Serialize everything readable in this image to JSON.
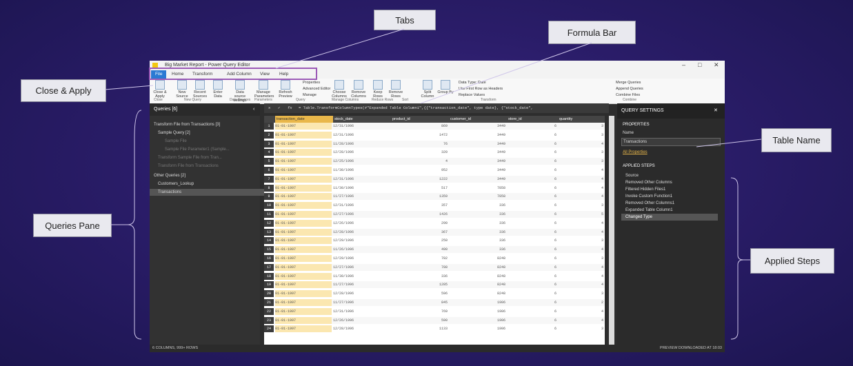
{
  "callouts": {
    "tabs": "Tabs",
    "formula_bar": "Formula Bar",
    "close_apply": "Close & Apply",
    "table_name": "Table Name",
    "queries_pane": "Queries Pane",
    "applied_steps": "Applied Steps"
  },
  "window": {
    "title": "Big Market Report - Power Query Editor",
    "minimize": "–",
    "maximize": "□",
    "close": "✕"
  },
  "tabs": [
    "File",
    "Home",
    "Transform",
    "Add Column",
    "View",
    "Help"
  ],
  "ribbon": {
    "buttons": [
      "Close & Apply",
      "New Source",
      "Recent Sources",
      "Enter Data",
      "Data source settings",
      "Manage Parameters",
      "Refresh Preview",
      "Choose Columns",
      "Remove Columns",
      "Keep Rows",
      "Remove Rows",
      "Split Column",
      "Group By"
    ],
    "small": [
      "Properties",
      "Advanced Editor",
      "Manage",
      "Data Type: Date",
      "Use First Row as Headers",
      "Replace Values",
      "Merge Queries",
      "Append Queries",
      "Combine Files"
    ],
    "groups": [
      "Close",
      "New Query",
      "Data Sources",
      "Parameters",
      "Query",
      "Manage Columns",
      "Reduce Rows",
      "Sort",
      "Transform",
      "Combine"
    ]
  },
  "queries": {
    "header": "Queries [6]",
    "items": [
      "Transform File from Transactions [3]",
      "Sample Query [2]",
      "Sample File",
      "Sample File Parameter1 (Sample...",
      "Transform Sample File from Tran...",
      "Transform File from Transactions",
      "Other Queries [2]",
      "Customers_Lookup",
      "Transactions"
    ]
  },
  "formula": "= Table.TransformColumnTypes(#\"Expanded Table Column1\",{{\"transaction_date\", type date}, {\"stock_date\",",
  "columns": [
    "transaction_date",
    "stock_date",
    "product_id",
    "customer_id",
    "store_id",
    "quantity"
  ],
  "rows": [
    [
      "01-01-1997",
      "12/31/1996",
      "869",
      "3449",
      "6",
      "3"
    ],
    [
      "01-01-1997",
      "12/31/1996",
      "1472",
      "3449",
      "6",
      "3"
    ],
    [
      "01-01-1997",
      "11/28/1996",
      "76",
      "3449",
      "6",
      "4"
    ],
    [
      "01-01-1997",
      "12/28/1996",
      "320",
      "3449",
      "6",
      "3"
    ],
    [
      "01-01-1997",
      "12/25/1996",
      "4",
      "3449",
      "6",
      "3"
    ],
    [
      "01-01-1997",
      "11/30/1996",
      "952",
      "3449",
      "6",
      "4"
    ],
    [
      "01-01-1997",
      "12/31/1996",
      "1222",
      "3449",
      "6",
      "4"
    ],
    [
      "01-01-1997",
      "11/30/1996",
      "517",
      "7858",
      "6",
      "4"
    ],
    [
      "01-01-1997",
      "11/27/1996",
      "1359",
      "7858",
      "6",
      "4"
    ],
    [
      "01-01-1997",
      "12/31/1996",
      "357",
      "336",
      "6",
      "3"
    ],
    [
      "01-01-1997",
      "12/27/1996",
      "1426",
      "336",
      "6",
      "5"
    ],
    [
      "01-01-1997",
      "12/26/1996",
      "290",
      "336",
      "6",
      "4"
    ],
    [
      "01-01-1997",
      "12/28/1996",
      "367",
      "336",
      "6",
      "4"
    ],
    [
      "01-01-1997",
      "12/29/1996",
      "250",
      "336",
      "6",
      "3"
    ],
    [
      "01-01-1997",
      "11/26/1996",
      "490",
      "336",
      "6",
      "4"
    ],
    [
      "01-01-1997",
      "12/29/1996",
      "782",
      "8248",
      "6",
      "3"
    ],
    [
      "01-01-1997",
      "12/27/1996",
      "788",
      "8248",
      "6",
      "4"
    ],
    [
      "01-01-1997",
      "11/30/1996",
      "336",
      "8248",
      "6",
      "4"
    ],
    [
      "01-01-1997",
      "11/27/1996",
      "1285",
      "8248",
      "6",
      "4"
    ],
    [
      "01-01-1997",
      "12/28/1996",
      "596",
      "8248",
      "6",
      "3"
    ],
    [
      "01-01-1997",
      "11/27/1996",
      "845",
      "1906",
      "6",
      "2"
    ],
    [
      "01-01-1997",
      "12/31/1996",
      "769",
      "1906",
      "6",
      "4"
    ],
    [
      "01-01-1997",
      "12/26/1996",
      "590",
      "1906",
      "6",
      "4"
    ],
    [
      "01-01-1997",
      "12/28/1996",
      "1133",
      "1906",
      "6",
      "3"
    ]
  ],
  "settings": {
    "header": "QUERY SETTINGS",
    "properties": "PROPERTIES",
    "name_label": "Name",
    "name_value": "Transactions",
    "all_props": "All Properties",
    "applied_steps": "APPLIED STEPS",
    "steps": [
      "Source",
      "Removed Other Columns",
      "Filtered Hidden Files1",
      "Invoke Custom Function1",
      "Removed Other Columns1",
      "Expanded Table Column1",
      "Changed Type"
    ]
  },
  "status": {
    "left": "6 COLUMNS, 999+ ROWS",
    "right": "PREVIEW DOWNLOADED AT 18:03"
  },
  "colors": {
    "accent": "#2b7ad3",
    "highlight": "#e9b74a",
    "callout_outline": "#9b59b6"
  }
}
